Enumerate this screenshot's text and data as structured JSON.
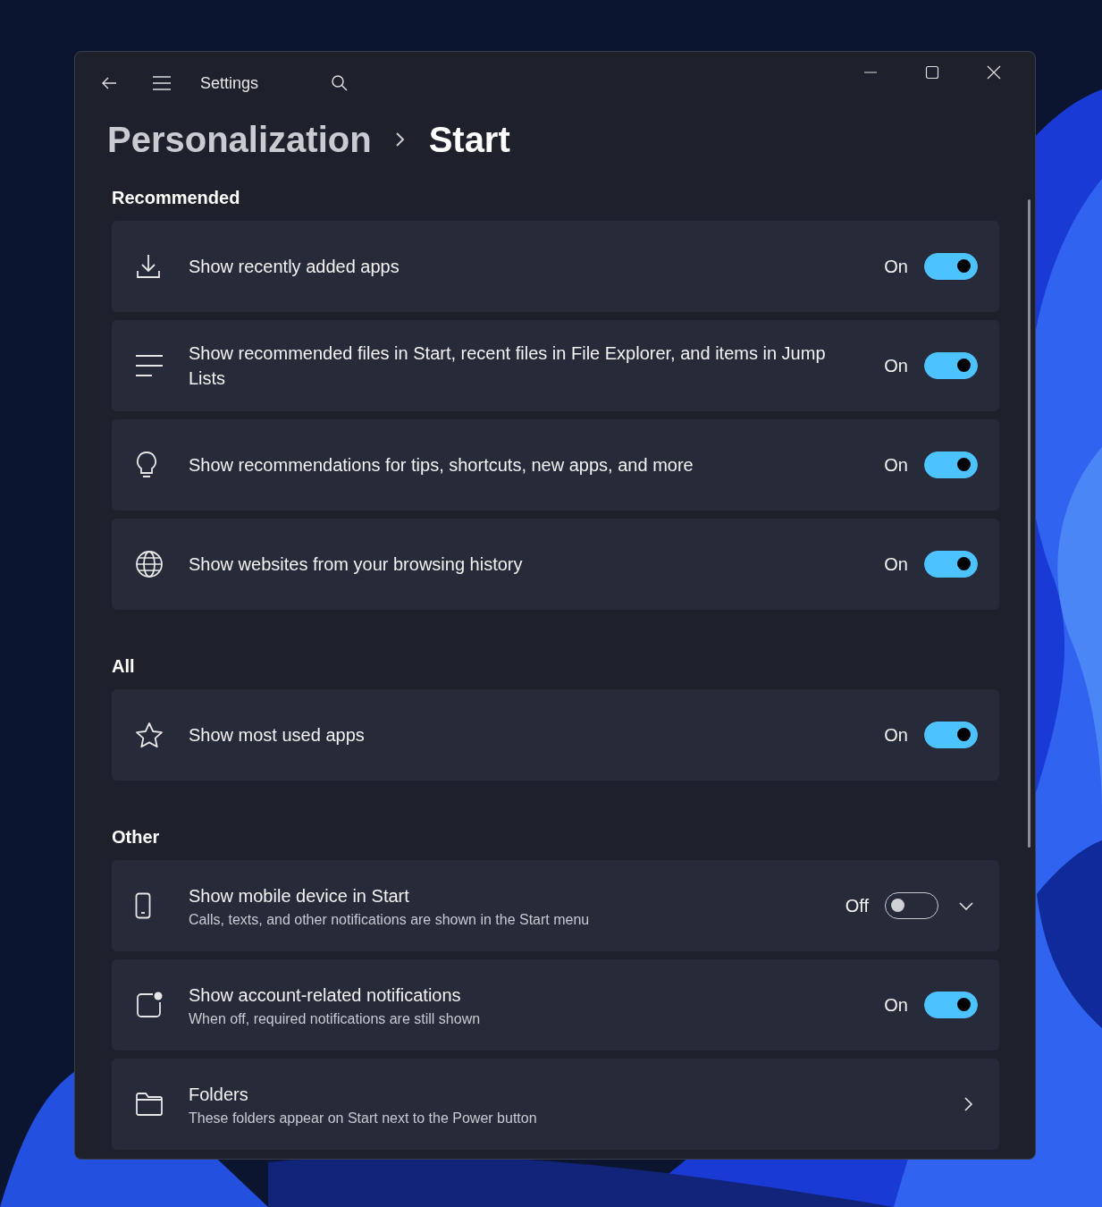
{
  "window": {
    "title": "Settings"
  },
  "breadcrumb": [
    {
      "label": "Personalization",
      "current": false
    },
    {
      "label": "Start",
      "current": true
    }
  ],
  "sections": [
    {
      "heading": "Recommended",
      "items": [
        {
          "kind": "toggle",
          "title": "Show recently added apps",
          "on": true,
          "state_label": "On"
        },
        {
          "kind": "toggle",
          "title": "Show recommended files in Start, recent files in File Explorer, and items in Jump Lists",
          "on": true,
          "state_label": "On"
        },
        {
          "kind": "toggle",
          "title": "Show recommendations for tips, shortcuts, new apps, and more",
          "on": true,
          "state_label": "On"
        },
        {
          "kind": "toggle",
          "title": "Show websites from your browsing history",
          "on": true,
          "state_label": "On"
        }
      ]
    },
    {
      "heading": "All",
      "items": [
        {
          "kind": "toggle",
          "title": "Show most used apps",
          "on": true,
          "state_label": "On"
        }
      ]
    },
    {
      "heading": "Other",
      "items": [
        {
          "kind": "toggle-expander",
          "title": "Show mobile device in Start",
          "subtitle": "Calls, texts, and other notifications are shown in the Start menu",
          "on": false,
          "state_label": "Off",
          "expanded": false
        },
        {
          "kind": "toggle",
          "title": "Show account-related notifications",
          "subtitle": "When off, required notifications are still shown",
          "on": true,
          "state_label": "On"
        },
        {
          "kind": "link",
          "title": "Folders",
          "subtitle": "These folders appear on Start next to the Power button"
        }
      ]
    }
  ]
}
